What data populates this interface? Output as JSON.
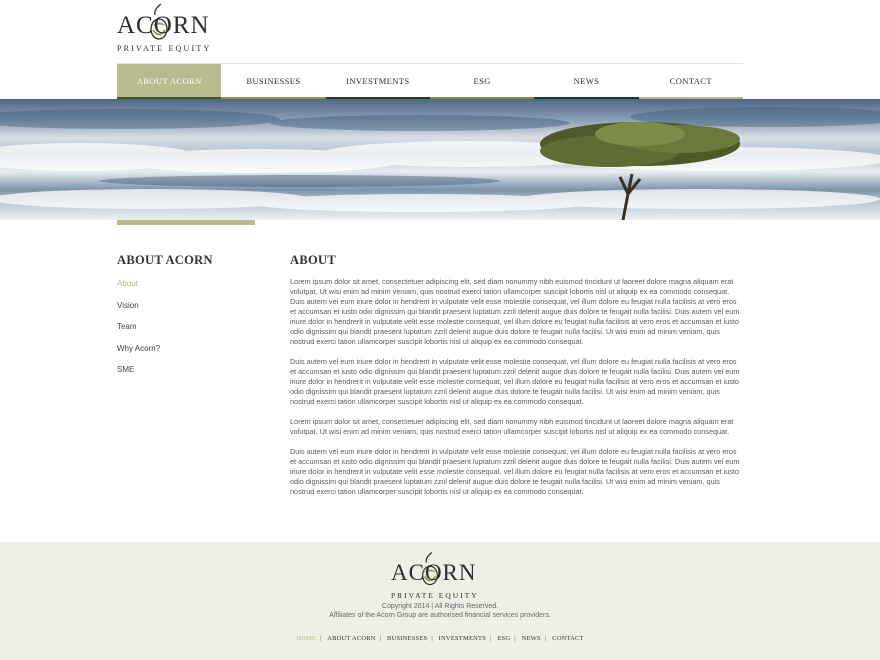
{
  "brand": {
    "name": "ACORN",
    "tagline": "PRIVATE EQUITY"
  },
  "nav": {
    "items": [
      {
        "label": "ABOUT ACORN",
        "active": true,
        "bar_color": "#3f5a1e"
      },
      {
        "label": "BUSINESSES",
        "active": false,
        "bar_color": "#8b9a3a"
      },
      {
        "label": "INVESTMENTS",
        "active": false,
        "bar_color": "#273a17"
      },
      {
        "label": "ESG",
        "active": false,
        "bar_color": "#8a8a3a"
      },
      {
        "label": "NEWS",
        "active": false,
        "bar_color": "#1e3a1e"
      },
      {
        "label": "CONTACT",
        "active": false,
        "bar_color": "#b7bb8e"
      }
    ]
  },
  "sidebar": {
    "title": "ABOUT ACORN",
    "items": [
      {
        "label": "About",
        "active": true
      },
      {
        "label": "Vision",
        "active": false
      },
      {
        "label": "Team",
        "active": false
      },
      {
        "label": "Why Acorn?",
        "active": false
      },
      {
        "label": "SME",
        "active": false
      }
    ]
  },
  "main": {
    "title": "ABOUT",
    "paragraphs": [
      "Lorem ipsum dolor sit amet, consectetuer adipiscing elit, sed diam nonummy nibh euismod tincidunt ut laoreet dolore magna aliquam erat volutpat. Ut wisi enim ad minim veniam, quis nostrud exerci tation ullamcorper suscipit lobortis nisl ut aliquip ex ea commodo consequat. Duis autem vel eum iriure dolor in hendrerit in vulputate velit esse molestie consequat, vel illum dolore eu feugiat nulla facilisis at vero eros et accumsan et iusto odio dignissim qui blandit praesent luptatum zzril delenit augue duis dolore te feugait nulla facilisi. Duis autem vel eum iriure dolor in hendrerit in vulputate velit esse molestie consequat, vel illum dolore eu feugiat nulla facilisis at vero eros et accumsan et iusto odio dignissim qui blandit praesent luptatum zzril delenit augue duis dolore te feugait nulla facilisi. Ut wisi enim ad minim veniam, quis nostrud exerci tation ullamcorper suscipit lobortis nisl ut aliquip ex ea commodo consequat.",
      "Duis autem vel eum iriure dolor in hendrerit in vulputate velit esse molestie consequat, vel illum dolore eu feugiat nulla facilisis at vero eros et accumsan et iusto odio dignissim qui blandit praesent luptatum zzril delenit augue duis dolore te feugait nulla facilisi. Duis autem vel eum iriure dolor in hendrerit in vulputate velit esse molestie consequat, vel illum dolore eu feugiat nulla facilisis at vero eros et accumsan et iusto odio dignissim qui blandit praesent luptatum zzril delenit augue duis dolore te feugait nulla facilisi. Ut wisi enim ad minim veniam, quis nostrud exerci tation ullamcorper suscipit lobortis nisl ut aliquip ex ea commodo consequat.",
      "Lorem ipsum dolor sit amet, consectetuer adipiscing elit, sed diam nonummy nibh euismod tincidunt ut laoreet dolore magna aliquam erat volutpat. Ut wisi enim ad minim veniam, quis nostrud exerci tation ullamcorper suscipit lobortis nisl ut aliquip ex ea commodo consequat.",
      "Duis autem vel eum iriure dolor in hendrerit in vulputate velit esse molestie consequat, vel illum dolore eu feugiat nulla facilisis at vero eros et accumsan et iusto odio dignissim qui blandit praesent luptatum zzril delenit augue duis dolore te feugait nulla facilisi. Duis autem vel eum iriure dolor in hendrerit in vulputate velit esse molestie consequat, vel illum dolore eu feugiat nulla facilisis at vero eros et accumsan et iusto odio dignissim qui blandit praesent luptatum zzril delenit augue duis dolore te feugait nulla facilisi. Ut wisi enim ad minim veniam, quis nostrud exerci tation ullamcorper suscipit lobortis nisl ut aliquip ex ea commodo consequat."
    ]
  },
  "footer": {
    "copyright": "Copyright 2014 | All Rights Reserved.",
    "affiliates": "Affiliates of the Acorn Group are authorised financial services providers.",
    "links": [
      {
        "label": "HOME",
        "active": true
      },
      {
        "label": "ABOUT ACORN",
        "active": false
      },
      {
        "label": "BUSINESSES",
        "active": false
      },
      {
        "label": "INVESTMENTS",
        "active": false
      },
      {
        "label": "ESG",
        "active": false
      },
      {
        "label": "NEWS",
        "active": false
      },
      {
        "label": "CONTACT",
        "active": false
      }
    ]
  },
  "colors": {
    "accent": "#b7bb8e",
    "footer_bg": "#efefe6",
    "text": "#5a5a5a"
  }
}
